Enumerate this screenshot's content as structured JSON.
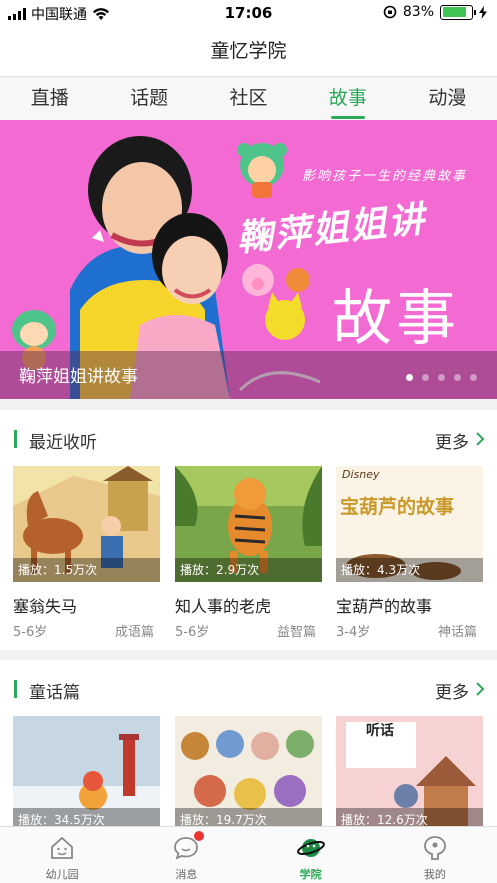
{
  "status_bar": {
    "carrier": "中国联通",
    "time": "17:06",
    "battery": "83%",
    "battery_level": 0.83
  },
  "header": {
    "title": "童忆学院"
  },
  "tabs": [
    {
      "label": "直播"
    },
    {
      "label": "话题"
    },
    {
      "label": "社区"
    },
    {
      "label": "故事",
      "active": true
    },
    {
      "label": "动漫"
    }
  ],
  "banner": {
    "caption": "鞠萍姐姐讲故事",
    "slogan": "影响孩子一生的经典故事",
    "title_line1": "鞠萍姐姐讲",
    "title_line2": "故事",
    "dots": 5,
    "active_dot": 1
  },
  "sections": [
    {
      "title": "最近收听",
      "more": "更多",
      "cards": [
        {
          "name": "塞翁失马",
          "plays": "播放：1.5万次",
          "age": "5-6岁",
          "category": "成语篇"
        },
        {
          "name": "知人事的老虎",
          "plays": "播放：2.9万次",
          "age": "5-6岁",
          "category": "益智篇"
        },
        {
          "name": "宝葫芦的故事",
          "plays": "播放：4.3万次",
          "age": "3-4岁",
          "category": "神话篇",
          "thumb_text": "宝葫芦的故事",
          "thumb_brand": "Disney"
        }
      ]
    },
    {
      "title": "童话篇",
      "more": "更多",
      "cards": [
        {
          "plays": "播放：34.5万次"
        },
        {
          "plays": "播放：19.7万次"
        },
        {
          "plays": "播放：12.6万次",
          "thumb_text": "听话"
        }
      ]
    }
  ],
  "bottom_nav": [
    {
      "label": "幼儿园",
      "icon": "house-icon"
    },
    {
      "label": "消息",
      "icon": "chat-bubble-icon",
      "badge": true
    },
    {
      "label": "学院",
      "icon": "planet-icon",
      "active": true
    },
    {
      "label": "我的",
      "icon": "profile-icon"
    }
  ],
  "colors": {
    "accent": "#2ea95a",
    "banner_bg": "#f36ad3",
    "badge": "#e33333"
  }
}
